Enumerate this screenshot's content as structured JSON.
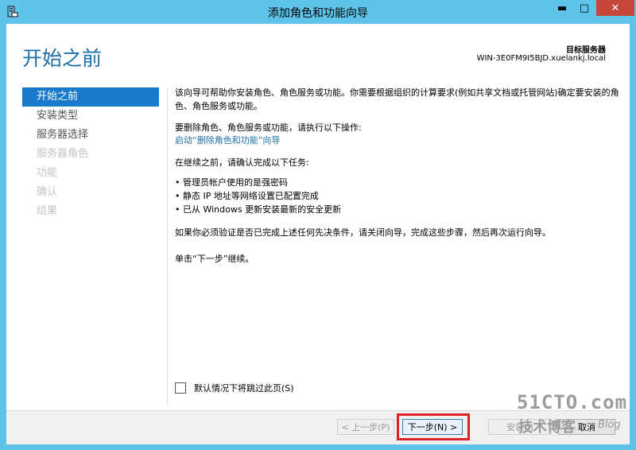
{
  "window": {
    "title": "添加角色和功能向导",
    "controls": {
      "minimize": "▬",
      "maximize": "□",
      "close": "✕"
    }
  },
  "header": {
    "page_title": "开始之前",
    "target_label": "目标服务器",
    "target_server": "WIN-3E0FM9I5BJD.xuelankj.local"
  },
  "nav": {
    "items": [
      {
        "label": "开始之前",
        "state": "active"
      },
      {
        "label": "安装类型",
        "state": "enabled"
      },
      {
        "label": "服务器选择",
        "state": "enabled"
      },
      {
        "label": "服务器角色",
        "state": "disabled"
      },
      {
        "label": "功能",
        "state": "disabled"
      },
      {
        "label": "确认",
        "state": "disabled"
      },
      {
        "label": "结果",
        "state": "disabled"
      }
    ]
  },
  "content": {
    "intro": "该向导可帮助你安装角色、角色服务或功能。你需要根据组织的计算要求(例如共享文档或托管网站)确定要安装的角色、角色服务或功能。",
    "remove_text": "要删除角色、角色服务或功能，请执行以下操作:",
    "remove_link": "启动“删除角色和功能”向导",
    "before_text": "在继续之前，请确认完成以下任务:",
    "tasks": [
      "管理员帐户使用的是强密码",
      "静态 IP 地址等网络设置已配置完成",
      "已从 Windows 更新安装最新的安全更新"
    ],
    "verify_text": "如果你必须验证是否已完成上述任何先决条件，请关闭向导，完成这些步骤，然后再次运行向导。",
    "click_text": "单击“下一步”继续。"
  },
  "skip": {
    "label": "默认情况下将跳过此页(S)",
    "checked": false
  },
  "footer": {
    "prev": "< 上一步(P)",
    "next": "下一步(N) >",
    "install": "安装(I)",
    "cancel": "取消"
  },
  "watermark": {
    "main": "51CTO.com",
    "sub": "技术博客",
    "blog": "Blog"
  },
  "colors": {
    "titlebar": "#5ec4ea",
    "accent": "#1d6fa5",
    "nav_active": "#1979ca",
    "close": "#c7463b",
    "highlight": "#e0202a"
  }
}
